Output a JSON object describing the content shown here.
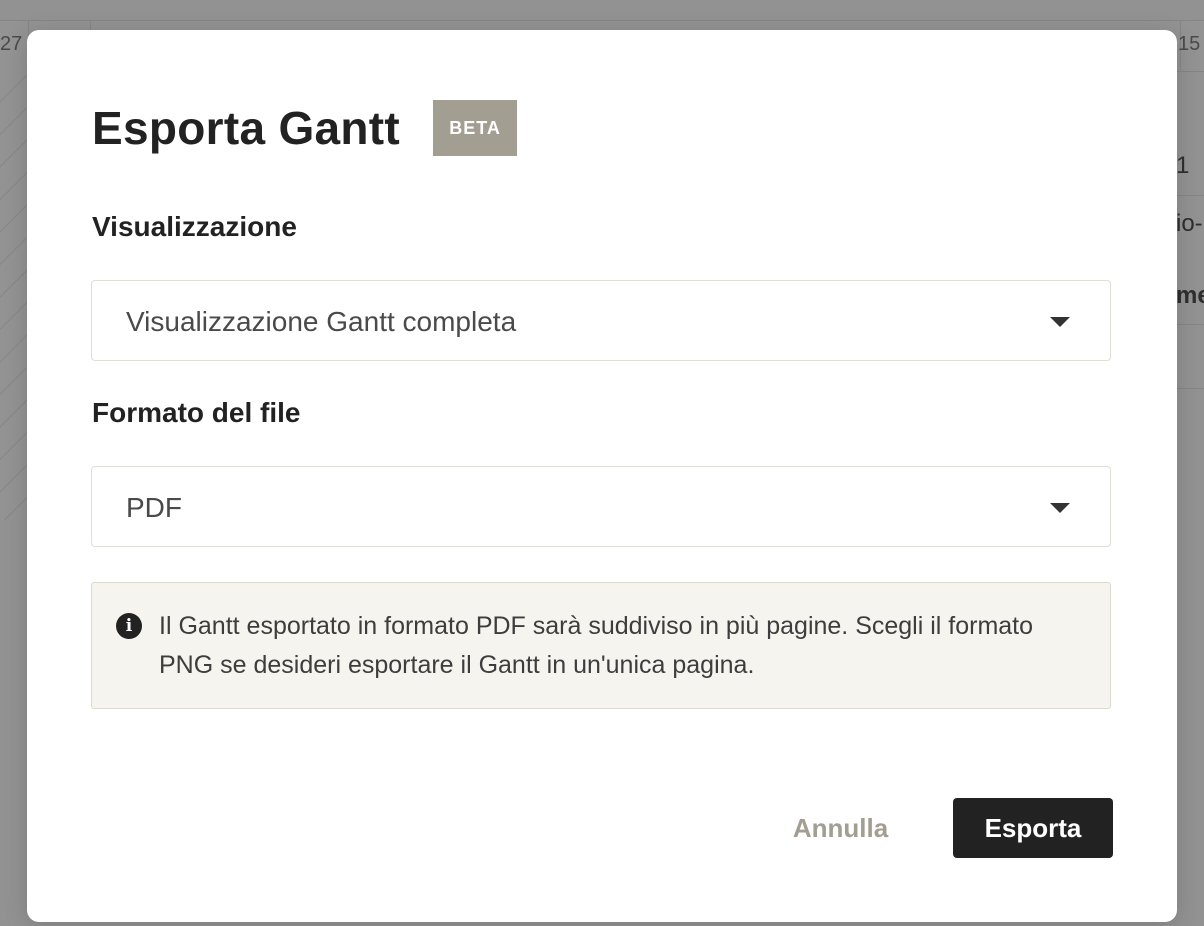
{
  "background": {
    "date_left": "27",
    "date_right": "15",
    "fragment_1": "1",
    "fragment_2": "io-",
    "fragment_3": "me"
  },
  "modal": {
    "title": "Esporta Gantt",
    "badge": "BETA",
    "view_field": {
      "label": "Visualizzazione",
      "value": "Visualizzazione Gantt completa"
    },
    "format_field": {
      "label": "Formato del file",
      "value": "PDF"
    },
    "info": {
      "icon": "info-icon",
      "text": "Il Gantt esportato in formato PDF sarà suddiviso in più pagine. Scegli il formato PNG se desideri esportare il Gantt in un'unica pagina."
    },
    "buttons": {
      "cancel": "Annulla",
      "export": "Esporta"
    }
  },
  "colors": {
    "overlay": "#929292",
    "badge": "#a39e92",
    "primary_button": "#222222",
    "info_background": "#f5f4ef",
    "cancel_text": "#a39e92"
  }
}
